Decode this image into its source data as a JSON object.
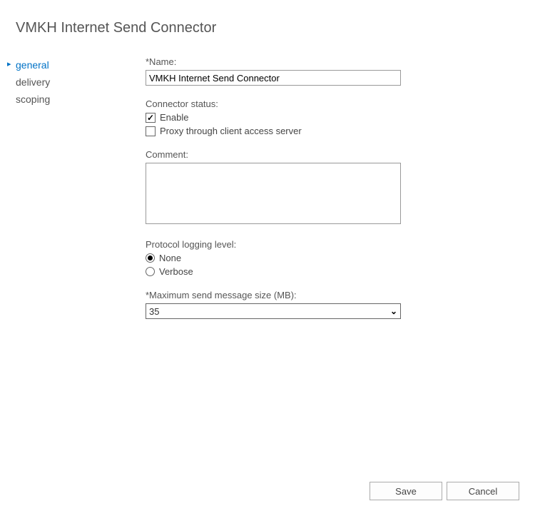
{
  "title": "VMKH Internet Send Connector",
  "sidebar": {
    "items": [
      {
        "label": "general",
        "active": true
      },
      {
        "label": "delivery",
        "active": false
      },
      {
        "label": "scoping",
        "active": false
      }
    ]
  },
  "form": {
    "name": {
      "label": "*Name:",
      "value": "VMKH Internet Send Connector"
    },
    "connector_status": {
      "label": "Connector status:",
      "enable": {
        "label": "Enable",
        "checked": true
      },
      "proxy": {
        "label": "Proxy through client access server",
        "checked": false
      }
    },
    "comment": {
      "label": "Comment:",
      "value": ""
    },
    "logging": {
      "label": "Protocol logging level:",
      "none": {
        "label": "None",
        "selected": true
      },
      "verbose": {
        "label": "Verbose",
        "selected": false
      }
    },
    "max_size": {
      "label": "*Maximum send message size (MB):",
      "value": "35"
    }
  },
  "buttons": {
    "save": "Save",
    "cancel": "Cancel"
  }
}
